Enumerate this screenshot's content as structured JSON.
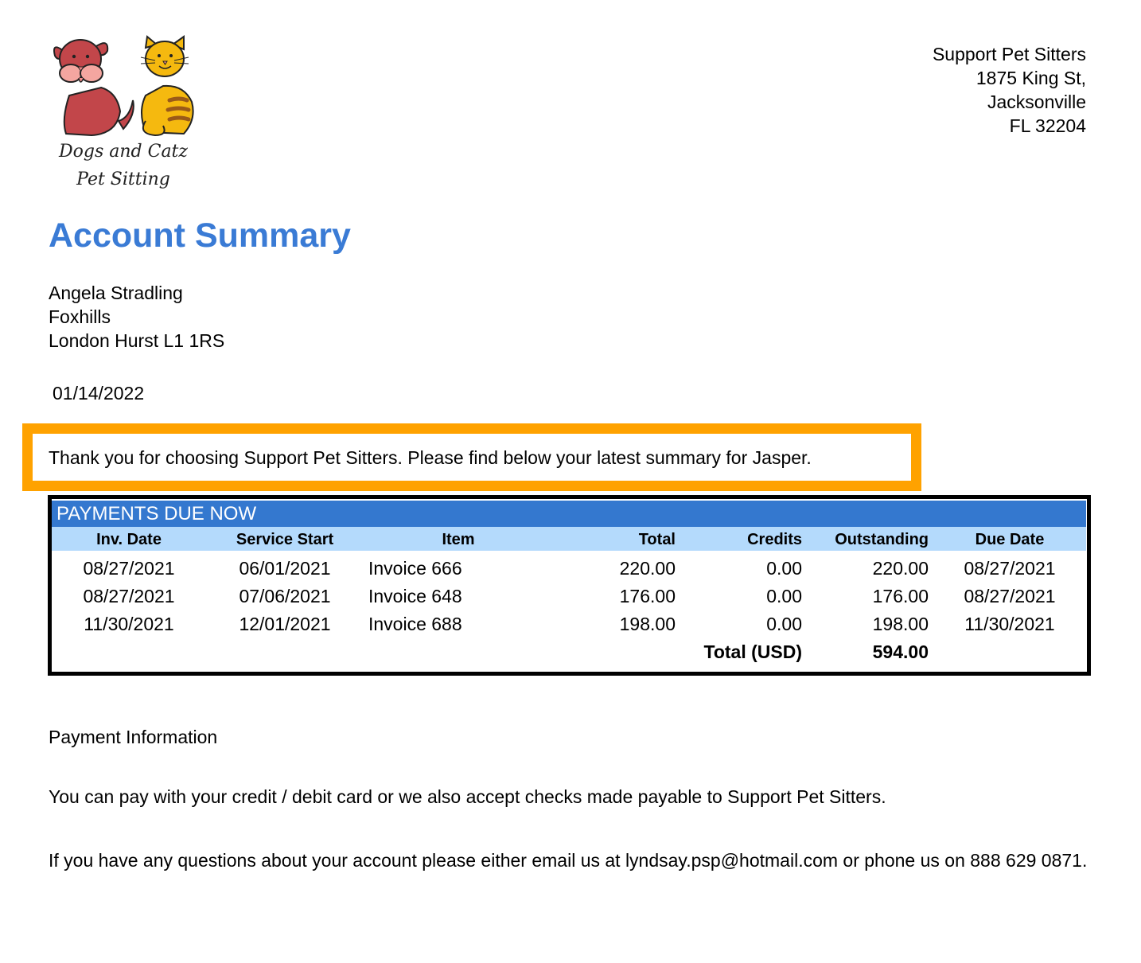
{
  "logo": {
    "line1": "Dogs and Catz",
    "line2": "Pet Sitting",
    "icon": "dog-and-cat-illustration"
  },
  "company": {
    "name": "Support Pet Sitters",
    "street": "1875 King St,",
    "city": "Jacksonville",
    "state_zip": "FL 32204"
  },
  "title": "Account Summary",
  "recipient": {
    "name": "Angela Stradling",
    "line2": "Foxhills",
    "line3": "London Hurst L1 1RS"
  },
  "date": "01/14/2022",
  "thanks": "Thank you for choosing Support Pet Sitters. Please find below your latest summary for Jasper.",
  "colors": {
    "title_blue": "#3a7bd5",
    "band_blue": "#3478cf",
    "header_light_blue": "#b4dafc",
    "highlight_orange": "#ffa200"
  },
  "payments": {
    "band_title": "PAYMENTS DUE NOW",
    "headers": [
      "Inv. Date",
      "Service Start",
      "Item",
      "Total",
      "Credits",
      "Outstanding",
      "Due Date"
    ],
    "rows": [
      [
        "08/27/2021",
        "06/01/2021",
        "Invoice 666",
        "220.00",
        "0.00",
        "220.00",
        "08/27/2021"
      ],
      [
        "08/27/2021",
        "07/06/2021",
        "Invoice 648",
        "176.00",
        "0.00",
        "176.00",
        "08/27/2021"
      ],
      [
        "11/30/2021",
        "12/01/2021",
        "Invoice 688",
        "198.00",
        "0.00",
        "198.00",
        "11/30/2021"
      ]
    ],
    "total_label": "Total (USD)",
    "total_value": "594.00"
  },
  "payment_info": {
    "heading": "Payment Information",
    "paragraph1": "You can pay with your credit / debit card or we also accept checks made payable to Support Pet Sitters.",
    "paragraph2": "If you have any questions about your account please either email us at lyndsay.psp@hotmail.com or phone us on 888 629 0871."
  }
}
